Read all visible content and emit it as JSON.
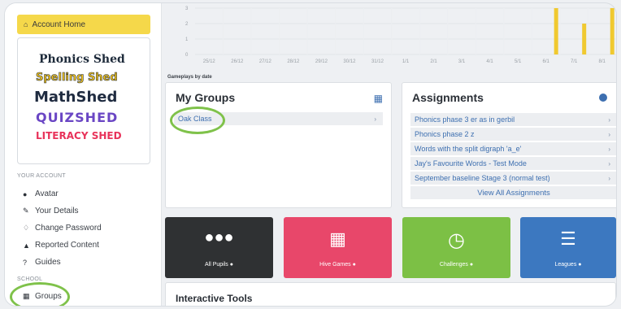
{
  "sidebar": {
    "home_label": "Account Home",
    "logos": [
      "Phonics Shed",
      "Spelling Shed",
      "MathShed",
      "QUIZSHED",
      "LITERACY SHED"
    ],
    "your_account_heading": "YOUR ACCOUNT",
    "account_items": [
      {
        "icon": "user-circle-icon",
        "label": "Avatar"
      },
      {
        "icon": "user-card-icon",
        "label": "Your Details"
      },
      {
        "icon": "key-icon",
        "label": "Change Password"
      },
      {
        "icon": "warning-icon",
        "label": "Reported Content"
      },
      {
        "icon": "question-icon",
        "label": "Guides"
      }
    ],
    "school_heading": "SCHOOL",
    "school_items": [
      {
        "icon": "grid-icon",
        "label": "Groups"
      }
    ]
  },
  "chart_data": {
    "type": "bar",
    "title": "",
    "xlabel": "Gameplays by date",
    "ylabel": "",
    "ylim": [
      0,
      3
    ],
    "yticks": [
      "0",
      "1",
      "2",
      "3"
    ],
    "categories": [
      "25/12",
      "26/12",
      "27/12",
      "28/12",
      "29/12",
      "30/12",
      "31/12",
      "1/1",
      "2/1",
      "3/1",
      "4/1",
      "5/1",
      "6/1",
      "7/1",
      "8/1"
    ],
    "values": [
      0,
      0,
      0,
      0,
      0,
      0,
      0,
      0,
      0,
      0,
      0,
      0,
      3,
      2,
      3
    ],
    "bar_color": "#f0c930"
  },
  "groups": {
    "title": "My Groups",
    "items": [
      "Oak Class"
    ]
  },
  "assignments": {
    "title": "Assignments",
    "items": [
      "Phonics phase 3 er as in gerbil",
      "Phonics phase 2 z",
      "Words with the split digraph 'a_e'",
      "Jay's Favourite Words - Test Mode",
      "September baseline Stage 3 (normal test)"
    ],
    "view_all": "View All Assignments"
  },
  "tiles": [
    {
      "label": "All Pupils",
      "color": "#2f3133",
      "icon": "pupils-icon"
    },
    {
      "label": "Hive Games",
      "color": "#e8476a",
      "icon": "hierarchy-icon"
    },
    {
      "label": "Challenges",
      "color": "#7cc045",
      "icon": "clock-icon"
    },
    {
      "label": "Leagues",
      "color": "#3c78c0",
      "icon": "list-icon"
    }
  ],
  "tools": {
    "title": "Interactive Tools"
  },
  "colors": {
    "highlight_ring": "#7fc24a",
    "home_button": "#f5d84a"
  }
}
